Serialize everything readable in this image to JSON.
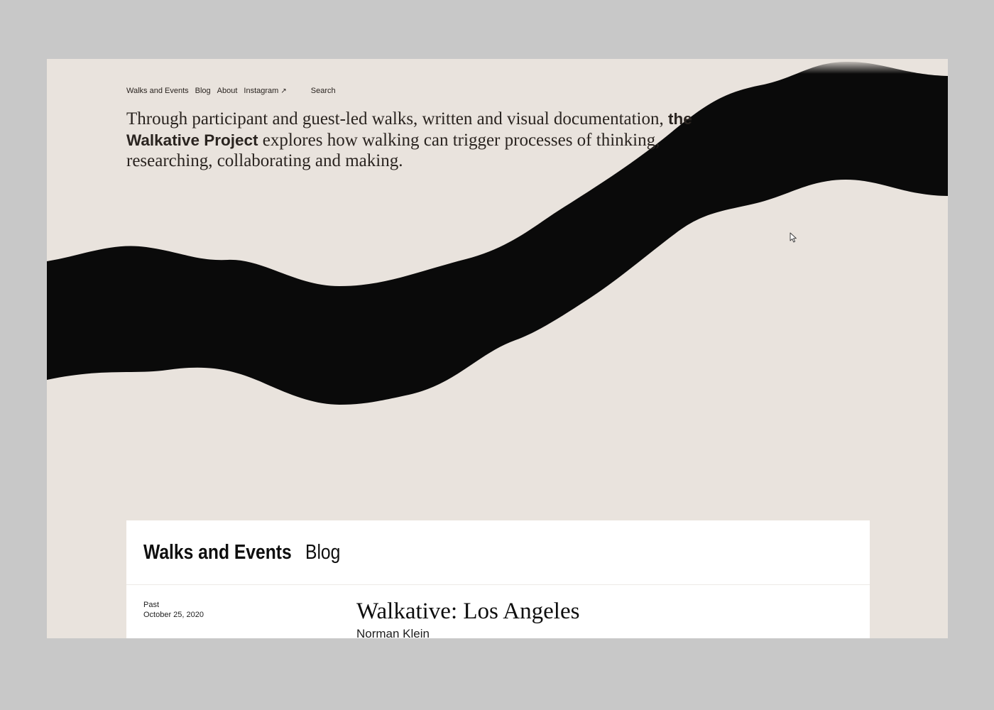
{
  "nav": {
    "walks_events": "Walks and Events",
    "blog": "Blog",
    "about": "About",
    "instagram": "Instagram",
    "instagram_arrow": "↗",
    "search": "Search"
  },
  "intro": {
    "text_before": "Through participant and guest-led walks, written and visual documentation,",
    "project_name": "the Walkative Project",
    "text_after": "explores how walking can trigger processes of thinking, researching, collaborating and making."
  },
  "panel": {
    "tabs": [
      {
        "label": "Walks and Events",
        "active": true
      },
      {
        "label": "Blog",
        "active": false
      }
    ],
    "events": [
      {
        "status": "Past",
        "date": "October 25, 2020",
        "title": "Walkative: Los Angeles",
        "author": "Norman Klein"
      }
    ]
  },
  "colors": {
    "background": "#e9e3dd",
    "outer": "#c8c8c8",
    "wave": "#0a0a0a",
    "panel": "#ffffff",
    "text": "#2a2420"
  },
  "icons": {
    "cursor": "mouse-pointer-icon",
    "external": "external-link-arrow-icon"
  }
}
